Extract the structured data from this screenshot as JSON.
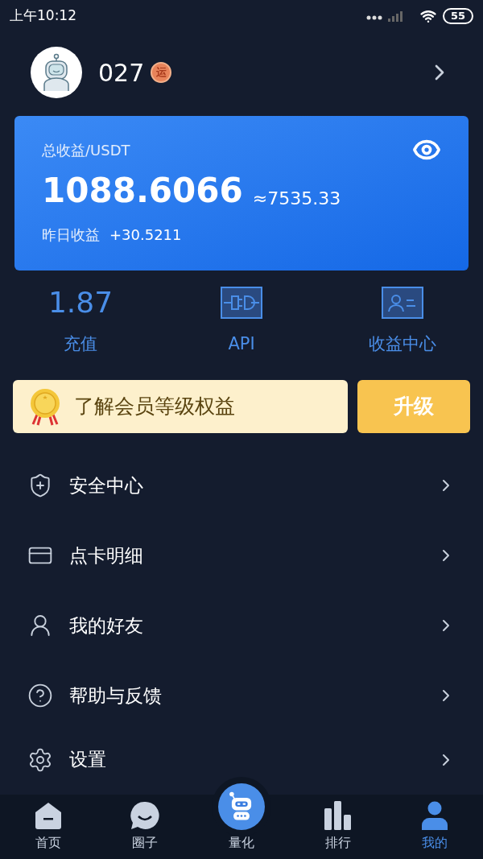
{
  "status_bar": {
    "time": "上午10:12",
    "battery": "55"
  },
  "profile": {
    "name": "027",
    "badge": "运"
  },
  "earnings": {
    "label": "总收益/USDT",
    "total": "1088.6066",
    "approx": "≈7535.33",
    "yesterday_label": "昨日收益",
    "yesterday_value": "+30.5211"
  },
  "shortcuts": [
    {
      "kind": "value",
      "value": "1.87",
      "label": "充值"
    },
    {
      "kind": "api",
      "label": "API"
    },
    {
      "kind": "income",
      "label": "收益中心"
    }
  ],
  "vip": {
    "text": "了解会员等级权益",
    "button": "升级"
  },
  "menu": [
    {
      "kind": "security",
      "label": "安全中心"
    },
    {
      "kind": "card",
      "label": "点卡明细"
    },
    {
      "kind": "friends",
      "label": "我的好友"
    },
    {
      "kind": "help",
      "label": "帮助与反馈"
    },
    {
      "kind": "settings",
      "label": "设置"
    }
  ],
  "tabs": [
    {
      "kind": "home",
      "label": "首页",
      "selected": false
    },
    {
      "kind": "circle",
      "label": "圈子",
      "selected": false
    },
    {
      "kind": "robot",
      "label": "量化",
      "selected": false
    },
    {
      "kind": "rank",
      "label": "排行",
      "selected": false
    },
    {
      "kind": "me",
      "label": "我的",
      "selected": true
    }
  ]
}
